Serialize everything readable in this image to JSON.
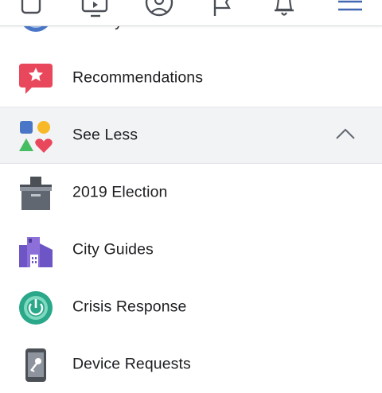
{
  "header": {
    "icons": [
      "home-icon",
      "watch-icon",
      "profile-icon",
      "pages-flag-icon",
      "notifications-bell-icon",
      "menu-icon"
    ]
  },
  "menu": {
    "partial_item": {
      "label": "Nearby Friends",
      "icon": "nearby-friends-icon"
    },
    "items": [
      {
        "label": "Recommendations",
        "icon": "recommendations-icon"
      },
      {
        "label": "See Less",
        "icon": "shapes-icon"
      },
      {
        "label": "2019 Election",
        "icon": "ballot-box-icon"
      },
      {
        "label": "City Guides",
        "icon": "city-guides-icon"
      },
      {
        "label": "Crisis Response",
        "icon": "crisis-response-icon"
      },
      {
        "label": "Device Requests",
        "icon": "device-requests-icon"
      }
    ]
  },
  "colors": {
    "accent": "#4267b2",
    "row_highlight": "#f2f3f5",
    "recommendations": "#e9475b",
    "crisis": "#2aa889",
    "city": "#8c6fd8",
    "ballot": "#606770"
  }
}
